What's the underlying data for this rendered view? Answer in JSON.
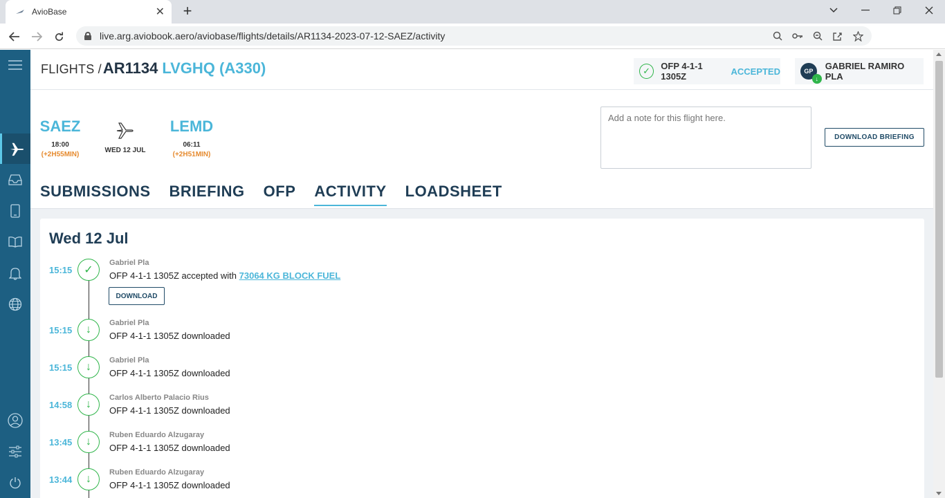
{
  "browser": {
    "tab_title": "AvioBase",
    "url": "live.arg.aviobook.aero/aviobase/flights/details/AR1134-2023-07-12-SAEZ/activity"
  },
  "header": {
    "breadcrumb_prefix": "FLIGHTS /",
    "flight_code": "AR1134",
    "aircraft": "LVGHQ (A330)",
    "ofp_label": "OFP 4-1-1 1305Z",
    "ofp_status": "ACCEPTED",
    "user_initials": "GP",
    "user_name": "GABRIEL RAMIRO PLA"
  },
  "flight": {
    "origin": {
      "code": "SAEZ",
      "time": "18:00",
      "delay": "(+2H55MIN)"
    },
    "date": "WED 12 JUL",
    "destination": {
      "code": "LEMD",
      "time": "06:11",
      "delay": "(+2H51MIN)"
    },
    "note_placeholder": "Add a note for this flight here.",
    "download_briefing_label": "DOWNLOAD BRIEFING"
  },
  "tabs": [
    "SUBMISSIONS",
    "BRIEFING",
    "OFP",
    "ACTIVITY",
    "LOADSHEET"
  ],
  "activity": {
    "day_heading": "Wed 12 Jul",
    "download_button_label": "DOWNLOAD",
    "entries": [
      {
        "time": "15:15",
        "user": "Gabriel Pla",
        "message": "OFP 4-1-1 1305Z accepted with ",
        "link": "73064 KG BLOCK FUEL",
        "icon": "check-icon"
      },
      {
        "time": "15:15",
        "user": "Gabriel Pla",
        "message": "OFP 4-1-1 1305Z downloaded",
        "icon": "download-icon"
      },
      {
        "time": "15:15",
        "user": "Gabriel Pla",
        "message": "OFP 4-1-1 1305Z downloaded",
        "icon": "download-icon"
      },
      {
        "time": "14:58",
        "user": "Carlos Alberto Palacio Rius",
        "message": "OFP 4-1-1 1305Z downloaded",
        "icon": "download-icon"
      },
      {
        "time": "13:45",
        "user": "Ruben Eduardo Alzugaray",
        "message": "OFP 4-1-1 1305Z downloaded",
        "icon": "download-icon"
      },
      {
        "time": "13:44",
        "user": "Ruben Eduardo Alzugaray",
        "message": "OFP 4-1-1 1305Z downloaded",
        "icon": "download-icon"
      }
    ]
  },
  "colors": {
    "sidebar": "#1d5f82",
    "accent": "#4bb6d9",
    "success": "#2fb54a",
    "delay": "#e68a2e"
  }
}
